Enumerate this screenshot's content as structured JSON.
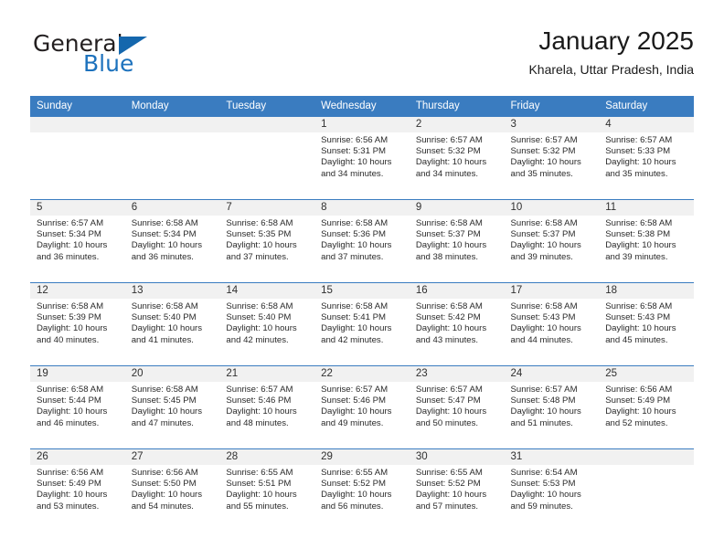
{
  "brand": {
    "name_part1": "General",
    "name_part2": "Blue",
    "triangle_color": "#1567ad",
    "blue_color": "#1d72bd"
  },
  "header": {
    "title": "January 2025",
    "location": "Kharela, Uttar Pradesh, India"
  },
  "theme": {
    "header_bg": "#3a7cc0",
    "daynum_bg": "#f1f1f1",
    "grid_line": "#3a7cc0"
  },
  "weekdays": [
    "Sunday",
    "Monday",
    "Tuesday",
    "Wednesday",
    "Thursday",
    "Friday",
    "Saturday"
  ],
  "weeks": [
    [
      {
        "day": "",
        "sunrise": "",
        "sunset": "",
        "daylight": "",
        "empty": true
      },
      {
        "day": "",
        "sunrise": "",
        "sunset": "",
        "daylight": "",
        "empty": true
      },
      {
        "day": "",
        "sunrise": "",
        "sunset": "",
        "daylight": "",
        "empty": true
      },
      {
        "day": "1",
        "sunrise": "Sunrise: 6:56 AM",
        "sunset": "Sunset: 5:31 PM",
        "daylight": "Daylight: 10 hours and 34 minutes."
      },
      {
        "day": "2",
        "sunrise": "Sunrise: 6:57 AM",
        "sunset": "Sunset: 5:32 PM",
        "daylight": "Daylight: 10 hours and 34 minutes."
      },
      {
        "day": "3",
        "sunrise": "Sunrise: 6:57 AM",
        "sunset": "Sunset: 5:32 PM",
        "daylight": "Daylight: 10 hours and 35 minutes."
      },
      {
        "day": "4",
        "sunrise": "Sunrise: 6:57 AM",
        "sunset": "Sunset: 5:33 PM",
        "daylight": "Daylight: 10 hours and 35 minutes."
      }
    ],
    [
      {
        "day": "5",
        "sunrise": "Sunrise: 6:57 AM",
        "sunset": "Sunset: 5:34 PM",
        "daylight": "Daylight: 10 hours and 36 minutes."
      },
      {
        "day": "6",
        "sunrise": "Sunrise: 6:58 AM",
        "sunset": "Sunset: 5:34 PM",
        "daylight": "Daylight: 10 hours and 36 minutes."
      },
      {
        "day": "7",
        "sunrise": "Sunrise: 6:58 AM",
        "sunset": "Sunset: 5:35 PM",
        "daylight": "Daylight: 10 hours and 37 minutes."
      },
      {
        "day": "8",
        "sunrise": "Sunrise: 6:58 AM",
        "sunset": "Sunset: 5:36 PM",
        "daylight": "Daylight: 10 hours and 37 minutes."
      },
      {
        "day": "9",
        "sunrise": "Sunrise: 6:58 AM",
        "sunset": "Sunset: 5:37 PM",
        "daylight": "Daylight: 10 hours and 38 minutes."
      },
      {
        "day": "10",
        "sunrise": "Sunrise: 6:58 AM",
        "sunset": "Sunset: 5:37 PM",
        "daylight": "Daylight: 10 hours and 39 minutes."
      },
      {
        "day": "11",
        "sunrise": "Sunrise: 6:58 AM",
        "sunset": "Sunset: 5:38 PM",
        "daylight": "Daylight: 10 hours and 39 minutes."
      }
    ],
    [
      {
        "day": "12",
        "sunrise": "Sunrise: 6:58 AM",
        "sunset": "Sunset: 5:39 PM",
        "daylight": "Daylight: 10 hours and 40 minutes."
      },
      {
        "day": "13",
        "sunrise": "Sunrise: 6:58 AM",
        "sunset": "Sunset: 5:40 PM",
        "daylight": "Daylight: 10 hours and 41 minutes."
      },
      {
        "day": "14",
        "sunrise": "Sunrise: 6:58 AM",
        "sunset": "Sunset: 5:40 PM",
        "daylight": "Daylight: 10 hours and 42 minutes."
      },
      {
        "day": "15",
        "sunrise": "Sunrise: 6:58 AM",
        "sunset": "Sunset: 5:41 PM",
        "daylight": "Daylight: 10 hours and 42 minutes."
      },
      {
        "day": "16",
        "sunrise": "Sunrise: 6:58 AM",
        "sunset": "Sunset: 5:42 PM",
        "daylight": "Daylight: 10 hours and 43 minutes."
      },
      {
        "day": "17",
        "sunrise": "Sunrise: 6:58 AM",
        "sunset": "Sunset: 5:43 PM",
        "daylight": "Daylight: 10 hours and 44 minutes."
      },
      {
        "day": "18",
        "sunrise": "Sunrise: 6:58 AM",
        "sunset": "Sunset: 5:43 PM",
        "daylight": "Daylight: 10 hours and 45 minutes."
      }
    ],
    [
      {
        "day": "19",
        "sunrise": "Sunrise: 6:58 AM",
        "sunset": "Sunset: 5:44 PM",
        "daylight": "Daylight: 10 hours and 46 minutes."
      },
      {
        "day": "20",
        "sunrise": "Sunrise: 6:58 AM",
        "sunset": "Sunset: 5:45 PM",
        "daylight": "Daylight: 10 hours and 47 minutes."
      },
      {
        "day": "21",
        "sunrise": "Sunrise: 6:57 AM",
        "sunset": "Sunset: 5:46 PM",
        "daylight": "Daylight: 10 hours and 48 minutes."
      },
      {
        "day": "22",
        "sunrise": "Sunrise: 6:57 AM",
        "sunset": "Sunset: 5:46 PM",
        "daylight": "Daylight: 10 hours and 49 minutes."
      },
      {
        "day": "23",
        "sunrise": "Sunrise: 6:57 AM",
        "sunset": "Sunset: 5:47 PM",
        "daylight": "Daylight: 10 hours and 50 minutes."
      },
      {
        "day": "24",
        "sunrise": "Sunrise: 6:57 AM",
        "sunset": "Sunset: 5:48 PM",
        "daylight": "Daylight: 10 hours and 51 minutes."
      },
      {
        "day": "25",
        "sunrise": "Sunrise: 6:56 AM",
        "sunset": "Sunset: 5:49 PM",
        "daylight": "Daylight: 10 hours and 52 minutes."
      }
    ],
    [
      {
        "day": "26",
        "sunrise": "Sunrise: 6:56 AM",
        "sunset": "Sunset: 5:49 PM",
        "daylight": "Daylight: 10 hours and 53 minutes."
      },
      {
        "day": "27",
        "sunrise": "Sunrise: 6:56 AM",
        "sunset": "Sunset: 5:50 PM",
        "daylight": "Daylight: 10 hours and 54 minutes."
      },
      {
        "day": "28",
        "sunrise": "Sunrise: 6:55 AM",
        "sunset": "Sunset: 5:51 PM",
        "daylight": "Daylight: 10 hours and 55 minutes."
      },
      {
        "day": "29",
        "sunrise": "Sunrise: 6:55 AM",
        "sunset": "Sunset: 5:52 PM",
        "daylight": "Daylight: 10 hours and 56 minutes."
      },
      {
        "day": "30",
        "sunrise": "Sunrise: 6:55 AM",
        "sunset": "Sunset: 5:52 PM",
        "daylight": "Daylight: 10 hours and 57 minutes."
      },
      {
        "day": "31",
        "sunrise": "Sunrise: 6:54 AM",
        "sunset": "Sunset: 5:53 PM",
        "daylight": "Daylight: 10 hours and 59 minutes."
      },
      {
        "day": "",
        "sunrise": "",
        "sunset": "",
        "daylight": "",
        "empty": true
      }
    ]
  ]
}
